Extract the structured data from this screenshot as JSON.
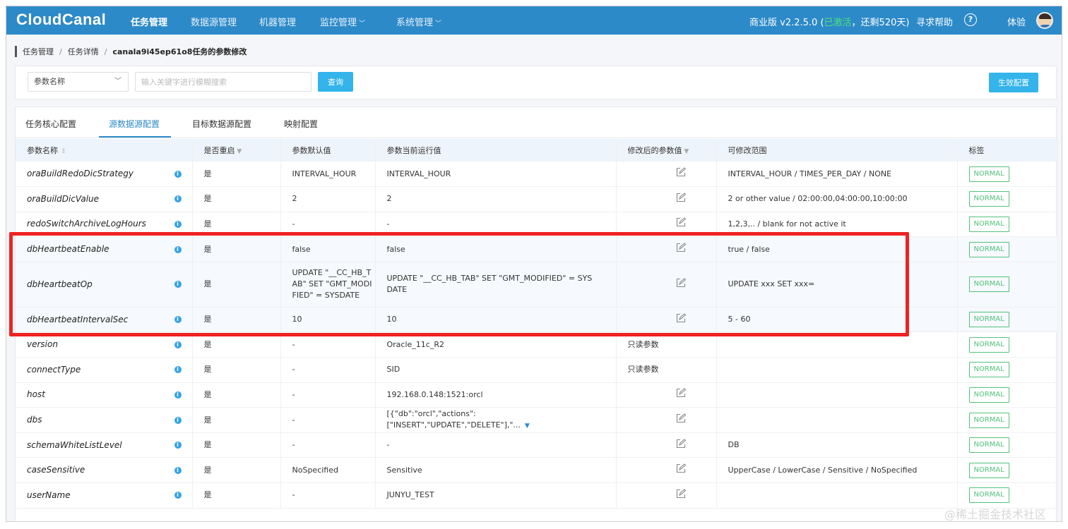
{
  "app": {
    "logo": "CloudCanal",
    "nav": [
      {
        "label": "任务管理",
        "active": true
      },
      {
        "label": "数据源管理",
        "active": false
      },
      {
        "label": "机器管理",
        "active": false
      },
      {
        "label": "监控管理",
        "active": false,
        "dropdown": true
      },
      {
        "label": "系统管理",
        "active": false,
        "dropdown": true
      }
    ],
    "edition": "商业版 v2.2.5.0",
    "activation_open": "(",
    "activation_status": "已激活",
    "activation_rest": "，还剩520天)",
    "help_link": "寻求帮助",
    "help_icon": "?",
    "user": "体验"
  },
  "breadcrumb": [
    "任务管理",
    "任务详情",
    "canala9i45ep61o8任务的参数修改"
  ],
  "breadcrumb_sep": "/",
  "filter": {
    "select_value": "参数名称",
    "search_placeholder": "输入关键字进行模糊搜索",
    "query_button": "查询",
    "apply_button": "生效配置"
  },
  "tabs": [
    "任务核心配置",
    "源数据源配置",
    "目标数据源配置",
    "映射配置"
  ],
  "active_tab": 1,
  "columns": [
    "参数名称",
    "是否重启",
    "参数默认值",
    "参数当前运行值",
    "修改后的参数值",
    "可修改范围",
    "标签"
  ],
  "rows": [
    {
      "name": "oraBuildRedoDicStrategy",
      "restart": "是",
      "default": "INTERVAL_HOUR",
      "current": "INTERVAL_HOUR",
      "modified": "",
      "range": "INTERVAL_HOUR / TIMES_PER_DAY / NONE",
      "tag": "NORMAL"
    },
    {
      "name": "oraBuildDicValue",
      "restart": "是",
      "default": "2",
      "current": "2",
      "modified": "",
      "range": "2 or other value / 02:00:00,04:00:00,10:00:00",
      "tag": "NORMAL"
    },
    {
      "name": "redoSwitchArchiveLogHours",
      "restart": "是",
      "default": "-",
      "current": "-",
      "modified": "",
      "range": "1,2,3,.. / blank for not active it",
      "tag": "NORMAL"
    },
    {
      "name": "dbHeartbeatEnable",
      "restart": "是",
      "default": "false",
      "current": "false",
      "modified": "",
      "range": "true / false",
      "tag": "NORMAL"
    },
    {
      "name": "dbHeartbeatOp",
      "restart": "是",
      "default": "UPDATE \"__CC_HB_TAB\" SET \"GMT_MODIFIED\" = SYSDATE",
      "current": "UPDATE \"__CC_HB_TAB\" SET \"GMT_MODIFIED\" = SYSDATE",
      "modified": "",
      "range": "UPDATE xxx SET xxx=",
      "tag": "NORMAL"
    },
    {
      "name": "dbHeartbeatIntervalSec",
      "restart": "是",
      "default": "10",
      "current": "10",
      "modified": "",
      "range": "5 - 60",
      "tag": "NORMAL"
    },
    {
      "name": "version",
      "restart": "是",
      "default": "-",
      "current": "Oracle_11c_R2",
      "modified": "只读参数",
      "range": "",
      "tag": "NORMAL"
    },
    {
      "name": "connectType",
      "restart": "是",
      "default": "-",
      "current": "SID",
      "modified": "只读参数",
      "range": "",
      "tag": "NORMAL"
    },
    {
      "name": "host",
      "restart": "是",
      "default": "-",
      "current": "192.168.0.148:1521:orcl",
      "modified": "",
      "range": "",
      "tag": "NORMAL"
    },
    {
      "name": "dbs",
      "restart": "是",
      "default": "-",
      "current": "[{\"db\":\"orcl\",\"actions\":[\"INSERT\",\"UPDATE\",\"DELETE\"],\"...",
      "modified": "",
      "range": "",
      "tag": "NORMAL"
    },
    {
      "name": "schemaWhiteListLevel",
      "restart": "是",
      "default": "-",
      "current": "-",
      "modified": "",
      "range": "DB",
      "tag": "NORMAL"
    },
    {
      "name": "caseSensitive",
      "restart": "是",
      "default": "NoSpecified",
      "current": "Sensitive",
      "modified": "",
      "range": "UpperCase / LowerCase / Sensitive / NoSpecified",
      "tag": "NORMAL"
    },
    {
      "name": "userName",
      "restart": "是",
      "default": "-",
      "current": "JUNYU_TEST",
      "modified": "",
      "range": "",
      "tag": "NORMAL"
    }
  ],
  "colors": {
    "nav_bg": "#2d8ac9",
    "accent": "#33b4ea",
    "tag_green": "#53c27b",
    "highlight_red": "#ef2222"
  },
  "icons": {
    "edit": "edit-icon",
    "info": "info-icon",
    "filter": "filter-icon",
    "sort": "sort-icon"
  },
  "watermark": "@稀土掘金技术社区"
}
